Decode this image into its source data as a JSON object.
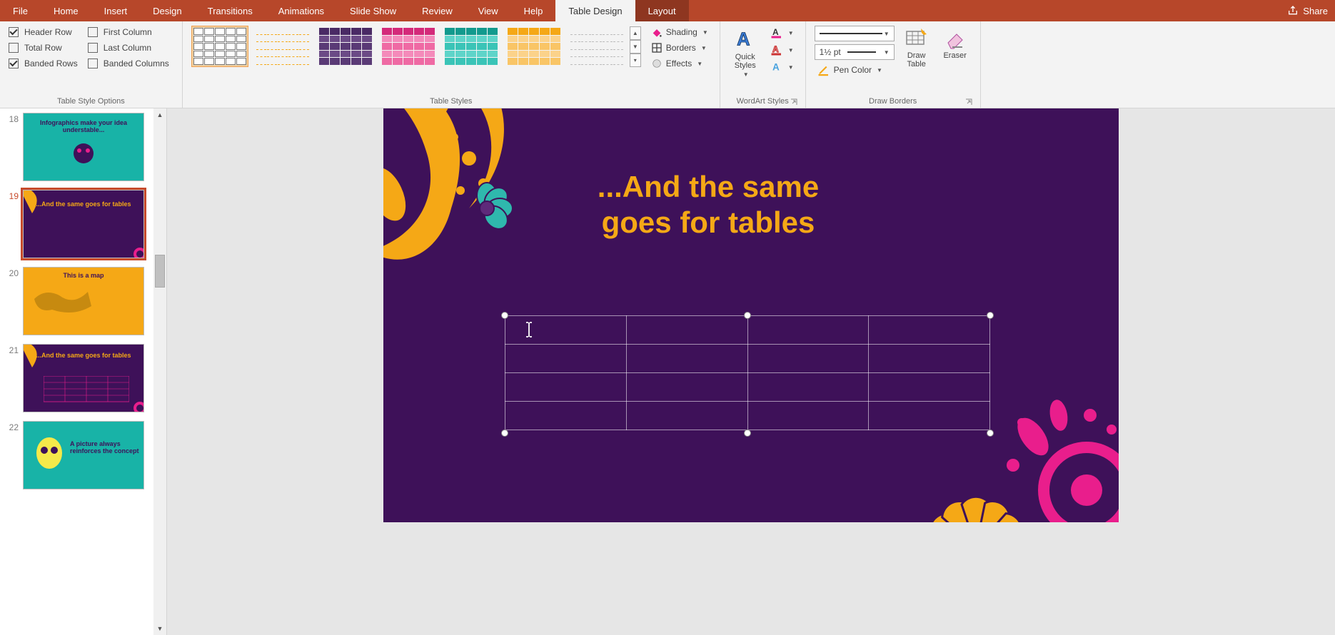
{
  "menu": {
    "tabs": [
      "File",
      "Home",
      "Insert",
      "Design",
      "Transitions",
      "Animations",
      "Slide Show",
      "Review",
      "View",
      "Help",
      "Table Design",
      "Layout"
    ],
    "active": "Table Design",
    "share": "Share"
  },
  "ribbon": {
    "tso": {
      "label": "Table Style Options",
      "header_row": "Header Row",
      "total_row": "Total Row",
      "banded_rows": "Banded Rows",
      "first_column": "First Column",
      "last_column": "Last Column",
      "banded_columns": "Banded Columns"
    },
    "styles": {
      "label": "Table Styles",
      "shading": "Shading",
      "borders": "Borders",
      "effects": "Effects"
    },
    "wordart": {
      "label": "WordArt Styles",
      "quick": "Quick Styles"
    },
    "draw": {
      "label": "Draw Borders",
      "weight": "1½ pt",
      "pen_color": "Pen Color",
      "draw_table": "Draw Table",
      "eraser": "Eraser"
    }
  },
  "thumbs": [
    {
      "num": "18",
      "title": "Infographics make your idea understable..."
    },
    {
      "num": "19",
      "title": "...And the same goes for tables"
    },
    {
      "num": "20",
      "title": "This is a map"
    },
    {
      "num": "21",
      "title": "...And the same goes for tables"
    },
    {
      "num": "22",
      "title": "A picture always reinforces the concept"
    }
  ],
  "slide": {
    "title_l1": "...And the same",
    "title_l2": "goes for tables"
  }
}
